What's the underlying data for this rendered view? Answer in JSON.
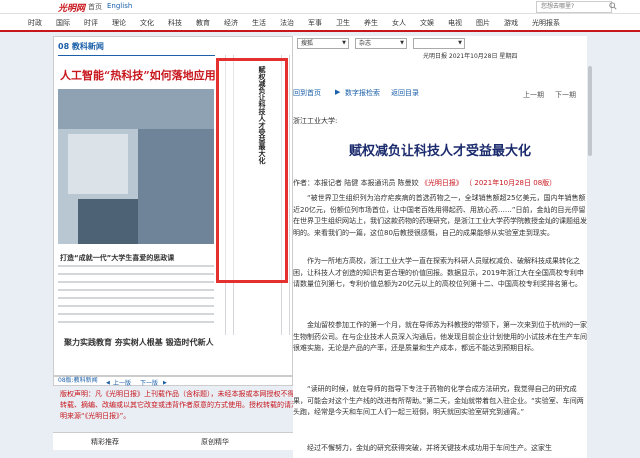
{
  "topbar": {
    "logo": "光明网",
    "home": "首页",
    "english": "English",
    "search_placeholder": "您想去哪里?"
  },
  "nav": [
    "时政",
    "国际",
    "时评",
    "理论",
    "文化",
    "科技",
    "教育",
    "经济",
    "生活",
    "法治",
    "军事",
    "卫生",
    "养生",
    "女人",
    "文娱",
    "电视",
    "图片",
    "游戏",
    "光明报系"
  ],
  "paper": {
    "edition": "08 教科新闻",
    "headline": "人工智能“热科技”如何落地应用",
    "sub1": "打造“成就一代”大学生喜爱的思政课",
    "sub2": "聚力实践教育  夯实树人根基  锻造时代新人",
    "highlight_title": "赋权减负让科技人才受益最大化",
    "footer_edition": "08版:教科新闻",
    "prev_page": "上一版",
    "next_page": "下一版"
  },
  "copyright": "版权声明：凡《光明日报》上刊载作品（含标题），未经本报或本网授权不得转载、摘编、改编或以其它改变或违背作者原意的方式使用。授权转载的请注明来源“《光明日报》”。",
  "tabs": [
    "精彩推荐",
    "原创精华"
  ],
  "toolbar": {
    "select1": "搜狐",
    "select2": "杂志",
    "date": "光明日报 2021年10月28日 星期四",
    "return_home": "回到首页",
    "digital_search": "数字报检索",
    "back_to_directory": "返回目录",
    "prev_article": "上一期",
    "next_article": "下一期"
  },
  "article": {
    "source": "浙江工业大学:",
    "title": "赋权减负让科技人才受益最大化",
    "byline": "作者：本报记者 陆健 本报通讯员 陈曼姣",
    "byline_source": "《光明日报》",
    "byline_date": "（ 2021年10月28日 08版）",
    "paragraphs": [
      "“被世界卫生组织列为治疗疟疾病的首选药物之一，全球销售额超25亿美元，国内年销售额近20亿元，份额位列市场首位，让中国老百姓用得起药、用放心药……”日前，金灿的目光停留在世界卫生组织网站上，我们这款药物的药理研究，是浙江工业大学药学院教授金灿的课题组发明的。来看我们的一篇，这位80后教授很感慨，自己的成果能够从实验室走到现实。",
      "作为一所地方高校，浙江工业大学一直在探索为科研人员赋权减负、破解科技成果转化之困，让科技人才创造的知识有更合理的价值回报。数据显示，2019年浙江大在全国高校专利申请数量位列第七，专利价值总额为20亿元以上的高校位列第十二、中国高校专利奖排名第七。",
      "金灿留校参加工作的第一个月，就在导师苏为科教授的带领下，第一次来到位于杭州的一家生物制药公司。在与企业技术人员深入沟通后，他发现目前企业计划使用的小试技术在生产车间很难实施，无论是产品的产率，还是质量和生产成本，都远不能达到预期目标。",
      "“读研的时候，就在导师的指导下专注于药物的化学合成方法研究，我觉得自己的研究成果，可能会对这个生产线的改进有所帮助。”第二天，金灿就带着包入驻企业。“实验室、车间两头跑，经常是今天和车间工人们一起三班倒，明天就回实验室研究到通宵。”",
      "经过不懈努力，金灿的研究获得突破，并将关键技术成功用于车间生产。这家生"
    ]
  }
}
